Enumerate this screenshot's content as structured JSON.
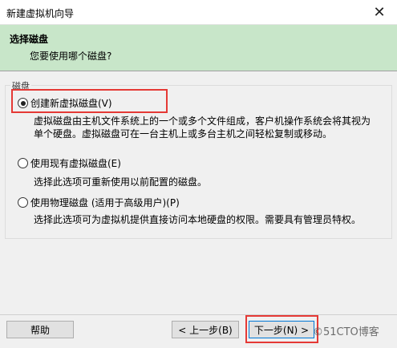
{
  "window": {
    "title": "新建虚拟机向导",
    "close_glyph": "✕"
  },
  "header": {
    "title": "选择磁盘",
    "subtitle": "您要使用哪个磁盘?"
  },
  "group": {
    "label": "磁盘"
  },
  "options": [
    {
      "label": "创建新虚拟磁盘(V)",
      "checked": true,
      "desc1": "虚拟磁盘由主机文件系统上的一个或多个文件组成，客户机操作系统会将其视为",
      "desc2": "单个硬盘。虚拟磁盘可在一台主机上或多台主机之间轻松复制或移动。"
    },
    {
      "label": "使用现有虚拟磁盘(E)",
      "checked": false,
      "desc1": "选择此选项可重新使用以前配置的磁盘。"
    },
    {
      "label": "使用物理磁盘 (适用于高级用户)(P)",
      "checked": false,
      "desc1": "选择此选项可为虚拟机提供直接访问本地硬盘的权限。需要具有管理员特权。"
    }
  ],
  "buttons": {
    "help": "帮助",
    "back": "< 上一步(B)",
    "next": "下一步(N) >"
  },
  "watermark": "©51CTO博客",
  "colors": {
    "header_band": "#c8e6c9",
    "highlight": "#e53935"
  }
}
